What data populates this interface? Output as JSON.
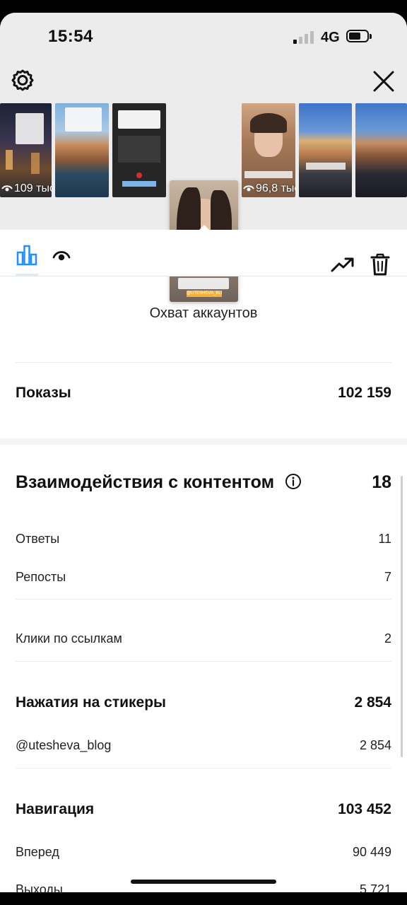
{
  "status_bar": {
    "time": "15:54",
    "network": "4G"
  },
  "stories": [
    {
      "views": "109 тыс",
      "theme": "night-city"
    },
    {
      "views": "",
      "theme": "canal-day"
    },
    {
      "views": "",
      "theme": "dark-text"
    },
    {
      "views": "",
      "theme": "selfie-selected",
      "sticker": "@UTESHEVA_BLOG"
    },
    {
      "views": "96,8 тыс",
      "theme": "selfie"
    },
    {
      "views": "",
      "theme": "gondolas"
    },
    {
      "views": "",
      "theme": "gondolas-2"
    }
  ],
  "toolbar": {
    "insights_icon": "bar-chart-icon",
    "viewers_icon": "eye-icon",
    "promote_icon": "trending-up-icon",
    "delete_icon": "trash-icon"
  },
  "reach": {
    "label": "Охват аккаунтов"
  },
  "impressions": {
    "label": "Показы",
    "value": "102 159"
  },
  "interactions": {
    "title": "Взаимодействия с контентом",
    "total": "18",
    "replies": {
      "label": "Ответы",
      "value": "11"
    },
    "shares": {
      "label": "Репосты",
      "value": "7"
    },
    "link_clicks": {
      "label": "Клики по ссылкам",
      "value": "2"
    }
  },
  "stickers": {
    "title": "Нажатия на стикеры",
    "total": "2 854",
    "item": {
      "label": "@utesheva_blog",
      "value": "2 854"
    }
  },
  "navigation": {
    "title": "Навигация",
    "total": "103 452",
    "forward": {
      "label": "Вперед",
      "value": "90 449"
    },
    "exits": {
      "label": "Выходы",
      "value": "5 721"
    }
  },
  "colors": {
    "accent": "#1e90ff",
    "background": "#ffffff",
    "header_bg": "#ececec"
  }
}
